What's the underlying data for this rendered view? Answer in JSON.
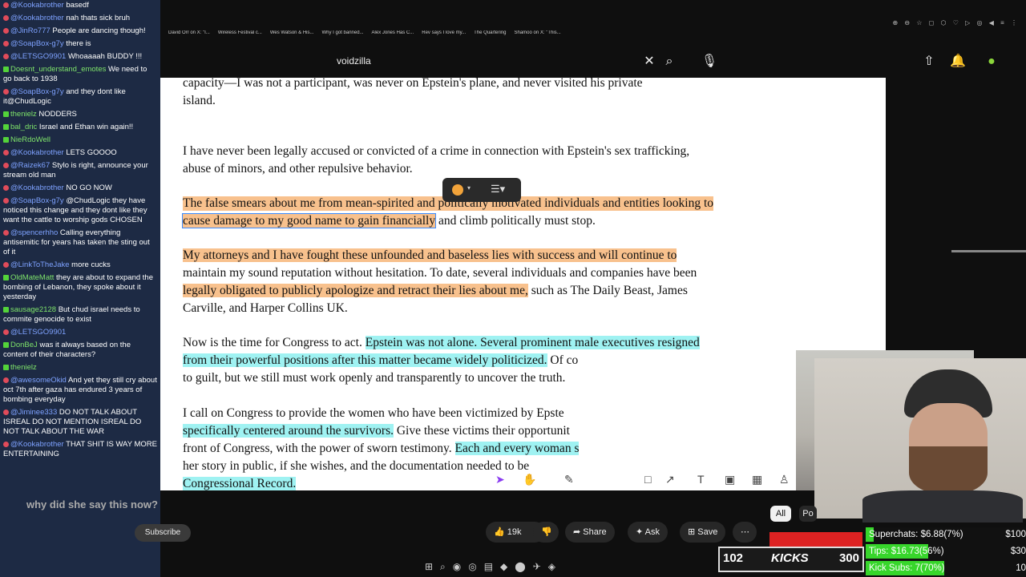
{
  "chat": [
    {
      "user": "@Kookabrother",
      "text": "basedf",
      "badge": "sub"
    },
    {
      "user": "@Kookabrother",
      "text": "nah thats sick bruh",
      "badge": "sub"
    },
    {
      "user": "@JinRo777",
      "text": "People are dancing though!",
      "badge": "sub"
    },
    {
      "user": "@SoapBox-g7y",
      "text": "there is",
      "badge": "sub"
    },
    {
      "user": "@LETSGO9901",
      "text": "Whoaaaah BUDDY !!!",
      "badge": "sub"
    },
    {
      "user": "Doesnt_understand_emotes",
      "text": "We need to go back to 1938",
      "badge": "kick"
    },
    {
      "user": "@SoapBox-g7y",
      "text": "and they dont like it@ChudLogic",
      "badge": "sub"
    },
    {
      "user": "thenielz",
      "text": "NODDERS",
      "badge": "kick"
    },
    {
      "user": "bal_dric",
      "text": "Israel and Ethan win again!!",
      "badge": "kick"
    },
    {
      "user": "NieRdoWell",
      "text": "",
      "badge": "kick"
    },
    {
      "user": "@Kookabrother",
      "text": "LETS GOOOO",
      "badge": "sub"
    },
    {
      "user": "@Raizek67",
      "text": "Stylo is right, announce your stream old man",
      "badge": "sub"
    },
    {
      "user": "@Kookabrother",
      "text": "NO GO NOW",
      "badge": "sub"
    },
    {
      "user": "@SoapBox-g7y",
      "text": "@ChudLogic they have noticed this change and they dont like they want the cattle to worship gods CHOSEN",
      "badge": "sub"
    },
    {
      "user": "@spencerhho",
      "text": "Calling everything antisemitic for years has taken the sting out of it",
      "badge": "sub"
    },
    {
      "user": "@LinkToTheJake",
      "text": "more cucks",
      "badge": "sub"
    },
    {
      "user": "OldMateMatt",
      "text": "they are about to expand the bombing of Lebanon, they spoke about it yesterday",
      "badge": "kick"
    },
    {
      "user": "sausage2128",
      "text": "But chud israel needs to commite genocide to exist",
      "badge": "kick"
    },
    {
      "user": "@LETSGO9901",
      "text": "",
      "badge": "sub"
    },
    {
      "user": "DonBeJ",
      "text": "was it always based on the content of their characters?",
      "badge": "kick"
    },
    {
      "user": "thenielz",
      "text": "",
      "badge": "kick"
    },
    {
      "user": "@awesomeOkid",
      "text": "And yet they still cry about oct 7th after gaza has endured 3 years of bombing everyday",
      "badge": "sub"
    },
    {
      "user": "@Jiminee333",
      "text": "DO NOT TALK ABOUT ISREAL DO NOT MENTION ISREAL DO NOT TALK ABOUT THE WAR",
      "badge": "sub"
    },
    {
      "user": "@Kookabrother",
      "text": "THAT SHIT IS WAY MORE ENTERTAINING",
      "badge": "sub"
    }
  ],
  "bookmarks": [
    "David Orr on X: \"I...",
    "Wireless Festival c...",
    "Wes Watson & His...",
    "Why I got banned...",
    "Alex Jones Has C...",
    "Rev says I love my...",
    "The Quartering",
    "Shamoo on X: \"This..."
  ],
  "youtube": {
    "search_value": "voidzilla",
    "caption": "why did she say this now?",
    "subscribe": "Subscribe",
    "likes": "19k",
    "share": "Share",
    "ask": "Ask",
    "save": "Save",
    "tab_all": "All",
    "tab_po": "Po"
  },
  "doc": {
    "l1": "capacity—I was not a participant, was never on Epstein's plane, and never visited his private",
    "l2": "island.",
    "l3": "I have never been legally accused or convicted of a crime in connection with Epstein's sex trafficking,",
    "l4": "abuse of minors, and other repulsive behavior.",
    "l5": "The false smears about me from mean-spirited and politically motivated individuals and entities looking to",
    "l6a": "cause damage to my good name to gain financially",
    "l6b": " and climb politically must stop.",
    "l7a": "My attorneys and I have fought these unfounded and baseless lies",
    "l7b": " with success and will continue to",
    "l8": "maintain my sound reputation without hesitation.  To date, several individuals and companies have been",
    "l9a": "legally obligated to publicly apologize and retract their lies about me,",
    "l9b": " such as The Daily Beast, James",
    "l10": "Carville, and Harper Collins UK.",
    "l11a": "Now is the time for Congress to act.  ",
    "l11b": "Epstein was not alone.  Several prominent male executives resigned",
    "l12a": "from their powerful positions after this matter became widely politicized.",
    "l12b": "  Of co",
    "l13": "to guilt, but we still must work openly and transparently to uncover the truth.",
    "l14": "I call on Congress to provide the women who have been victimized by Epste",
    "l15a": "specifically centered around the survivors.",
    "l15b": "  Give these victims their opportunit",
    "l16a": "front of Congress, with the power of sworn testimony.  ",
    "l16b": "Each and every woman s",
    "l17": "her story in public, if she wishes, and the documentation needed to be",
    "l18": "Congressional Record."
  },
  "kicks": {
    "left": "102",
    "label": "KICKS",
    "right": "300"
  },
  "stats": [
    {
      "label": "Superchats: $6.88(7%)",
      "value": "$100",
      "fill": 0.07
    },
    {
      "label": "Tips: $16.73(56%)",
      "value": "$30",
      "fill": 0.56
    },
    {
      "label": "Kick Subs: 7(70%)",
      "value": "10",
      "fill": 0.7
    }
  ],
  "colors": {
    "highlight_orange": "#f8c18d",
    "highlight_cyan": "#9ff2f2",
    "stat_green": "#37d62b",
    "chat_bg": "#1d2a44"
  }
}
